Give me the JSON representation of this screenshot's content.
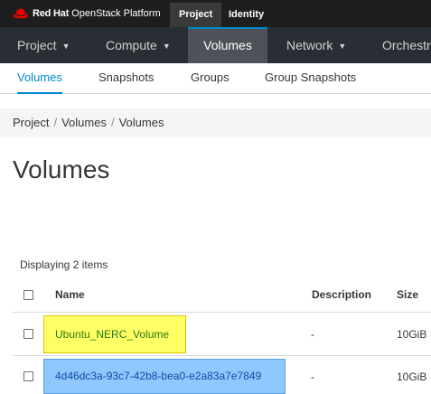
{
  "brand": {
    "name": "Red Hat",
    "product": "OpenStack Platform"
  },
  "top_tabs": [
    {
      "label": "Project",
      "active": true
    },
    {
      "label": "Identity",
      "active": false
    }
  ],
  "main_nav": [
    {
      "label": "Project",
      "has_caret": true
    },
    {
      "label": "Compute",
      "has_caret": true
    },
    {
      "label": "Volumes",
      "active": true
    },
    {
      "label": "Network",
      "has_caret": true
    },
    {
      "label": "Orchestra"
    }
  ],
  "sub_nav": [
    {
      "label": "Volumes",
      "active": true
    },
    {
      "label": "Snapshots"
    },
    {
      "label": "Groups"
    },
    {
      "label": "Group Snapshots"
    }
  ],
  "breadcrumb": [
    "Project",
    "Volumes",
    "Volumes"
  ],
  "page_title": "Volumes",
  "item_count": "Displaying 2 items",
  "table": {
    "columns": [
      "Name",
      "Description",
      "Size"
    ],
    "rows": [
      {
        "name": "Ubuntu_NERC_Volume",
        "description": "-",
        "size": "10GiB"
      },
      {
        "name": "4d46dc3a-93c7-42b8-bea0-e2a83a7e7849",
        "description": "-",
        "size": "10GiB"
      }
    ]
  },
  "colors": {
    "accent": "#0088ce",
    "topbar": "#1e1e1e",
    "navbar": "#292e34",
    "highlight_yellow": "#ffff66",
    "highlight_blue": "#8fc7ff"
  }
}
